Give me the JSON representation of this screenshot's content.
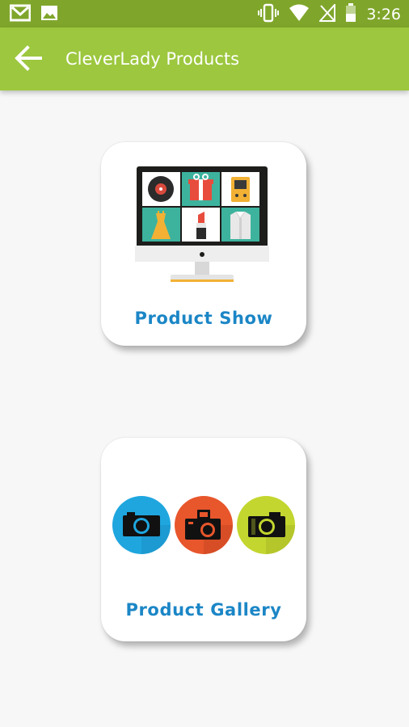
{
  "status_bar": {
    "time": "3:26",
    "left_icons": [
      "gmail-icon",
      "image-icon"
    ],
    "right_icons": [
      "vibrate-icon",
      "wifi-icon",
      "no-signal-icon",
      "battery-icon"
    ]
  },
  "app_bar": {
    "title": "CleverLady Products",
    "back_icon": "arrow-back-icon",
    "color": "#9cc73e"
  },
  "tiles": [
    {
      "label": "Product Show",
      "icon": "monitor-products-icon"
    },
    {
      "label": "Product Gallery",
      "icon": "cameras-icon"
    }
  ],
  "colors": {
    "status_bar": "#7fa62b",
    "accent_text": "#1b86c6",
    "background": "#f7f7f7"
  }
}
